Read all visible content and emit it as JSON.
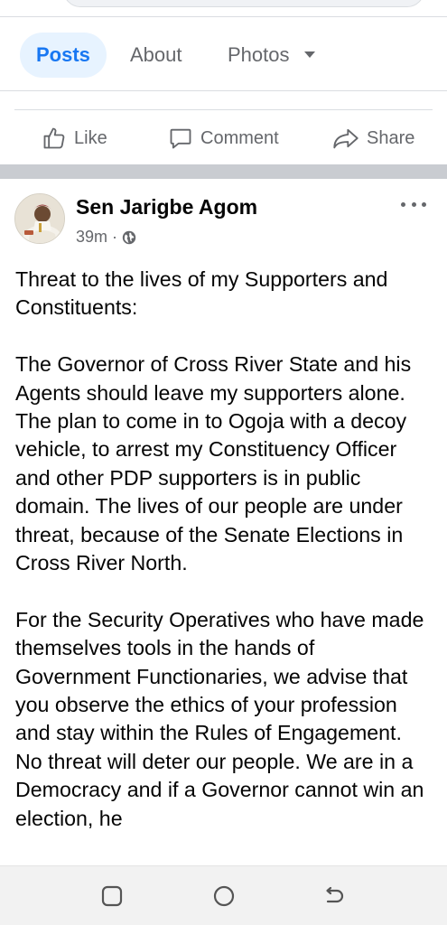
{
  "tabs": {
    "posts": "Posts",
    "about": "About",
    "photos": "Photos"
  },
  "actions": {
    "like": "Like",
    "comment": "Comment",
    "share": "Share"
  },
  "post": {
    "author": "Sen Jarigbe Agom",
    "time": "39m",
    "privacy_icon": "globe-icon",
    "paragraphs": [
      "Threat to the lives of my Supporters and Constituents:",
      "The Governor of Cross River State and his Agents should leave my supporters alone. The plan to come in to Ogoja with a decoy vehicle, to arrest my Constituency Officer and other PDP supporters is in public domain. The lives of our people are under threat, because of the Senate Elections in Cross River North.",
      "For the Security Operatives who have made themselves tools in the hands of Government Functionaries, we advise that you observe the ethics of your profession and stay within the Rules of Engagement. No threat will deter our people. We are in a Democracy and if a Governor cannot win an election, he"
    ]
  },
  "colors": {
    "accent": "#1877f2",
    "active_tab_bg": "#e7f3ff",
    "muted_text": "#65676b",
    "separator": "#c9ccd1",
    "navbar_bg": "#f2f2f2"
  }
}
